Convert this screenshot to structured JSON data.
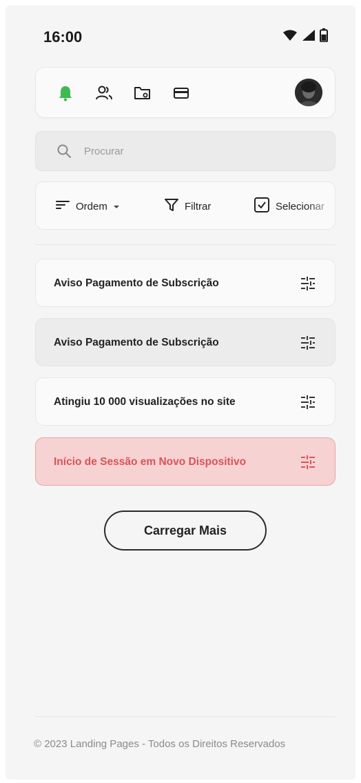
{
  "status_bar": {
    "time": "16:00"
  },
  "nav": {
    "icons": [
      "bell-icon",
      "users-icon",
      "folder-settings-icon",
      "credit-card-icon"
    ],
    "active_color": "#3fb950"
  },
  "search": {
    "placeholder": "Procurar",
    "value": ""
  },
  "toolbar": {
    "sort_label": "Ordem",
    "filter_label": "Filtrar",
    "select_label": "Selecionar"
  },
  "notifications": [
    {
      "title": "Aviso Pagamento de Subscrição",
      "state": "default"
    },
    {
      "title": "Aviso Pagamento de Subscrição",
      "state": "selected"
    },
    {
      "title": "Atingiu 10 000 visualizações no site",
      "state": "default"
    },
    {
      "title": "Início de Sessão em Novo Dispositivo",
      "state": "alert"
    }
  ],
  "colors": {
    "alert_text": "#d9535a",
    "alert_bg": "#f7d2d2"
  },
  "load_more_label": "Carregar Mais",
  "footer": {
    "text": "© 2023 Landing Pages - Todos os Direitos Reservados"
  }
}
